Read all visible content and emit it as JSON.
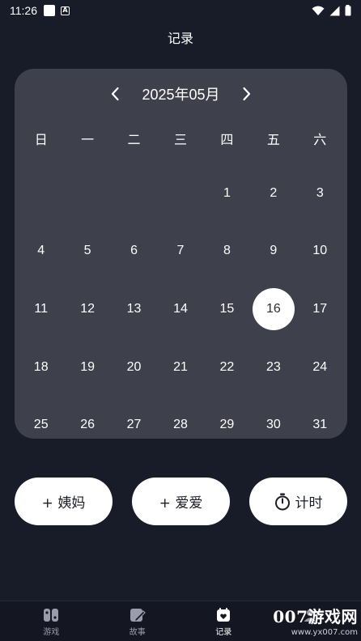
{
  "status_bar": {
    "time": "11:26"
  },
  "header": {
    "title": "记录"
  },
  "calendar": {
    "month_label": "2025年05月",
    "weekdays": [
      "日",
      "一",
      "二",
      "三",
      "四",
      "五",
      "六"
    ],
    "leading_blanks": 4,
    "days": [
      "1",
      "2",
      "3",
      "4",
      "5",
      "6",
      "7",
      "8",
      "9",
      "10",
      "11",
      "12",
      "13",
      "14",
      "15",
      "16",
      "17",
      "18",
      "19",
      "20",
      "21",
      "22",
      "23",
      "24",
      "25",
      "26",
      "27",
      "28",
      "29",
      "30",
      "31"
    ],
    "selected_day": "16"
  },
  "actions": [
    {
      "label": "+ 姨妈"
    },
    {
      "label": "+ 爱爱"
    },
    {
      "label": "计时",
      "icon": "stopwatch-icon"
    }
  ],
  "bottom_nav": [
    {
      "label": "游戏",
      "icon": "gamepad-icon",
      "active": false
    },
    {
      "label": "故事",
      "icon": "edit-note-icon",
      "active": false
    },
    {
      "label": "记录",
      "icon": "calendar-heart-icon",
      "active": true
    },
    {
      "label": "",
      "icon": "profile-icon",
      "active": false
    }
  ],
  "watermark": {
    "brand": "007游戏网",
    "url": "www.yx007.com"
  }
}
